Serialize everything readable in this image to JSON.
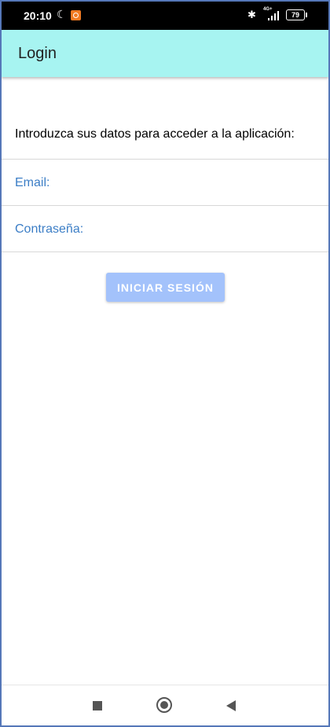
{
  "status_bar": {
    "time": "20:10",
    "moon_icon": "☾",
    "bluetooth_icon": "✱",
    "network": "4G+",
    "battery": "79"
  },
  "app_bar": {
    "title": "Login",
    "color": "#a7f4f1"
  },
  "form": {
    "intro": "Introduzca sus datos para acceder a la aplicación:",
    "email_label": "Email:",
    "password_label": "Contraseña:",
    "submit_label": "INICIAR SESIÓN",
    "label_color": "#3c7ec6",
    "button_color": "#a3c2fb"
  },
  "nav_bar": {
    "icons": [
      "recents-icon",
      "home-icon",
      "back-icon"
    ]
  }
}
